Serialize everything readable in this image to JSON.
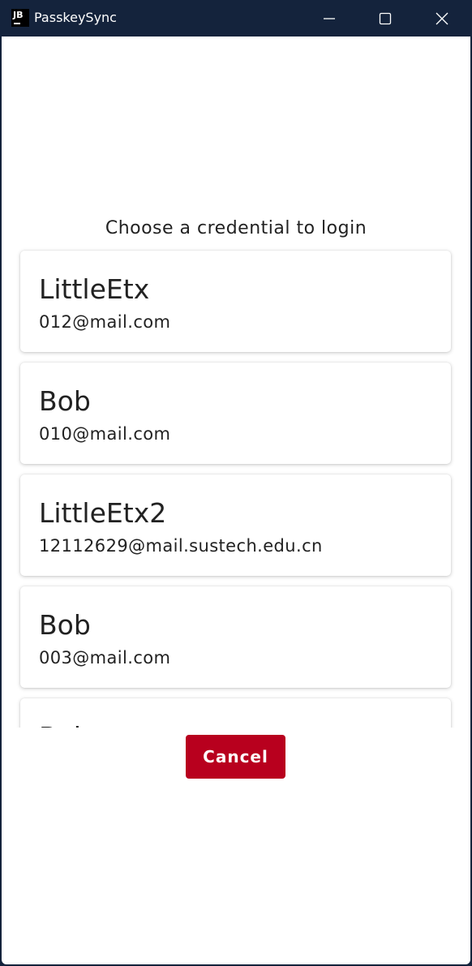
{
  "window": {
    "title": "PasskeySync",
    "app_icon_text": "JB",
    "colors": {
      "titlebar": "#14233c",
      "accent": "#b8001e"
    }
  },
  "titlebar_buttons": {
    "minimize_icon": "minimize-icon",
    "maximize_icon": "maximize-icon",
    "close_icon": "close-icon"
  },
  "main": {
    "heading": "Choose a credential to login",
    "credentials": [
      {
        "name": "LittleEtx",
        "email": "012@mail.com"
      },
      {
        "name": "Bob",
        "email": "010@mail.com"
      },
      {
        "name": "LittleEtx2",
        "email": "12112629@mail.sustech.edu.cn"
      },
      {
        "name": "Bob",
        "email": "003@mail.com"
      },
      {
        "name": "Bob",
        "email": ""
      }
    ],
    "cancel_label": "Cancel"
  }
}
